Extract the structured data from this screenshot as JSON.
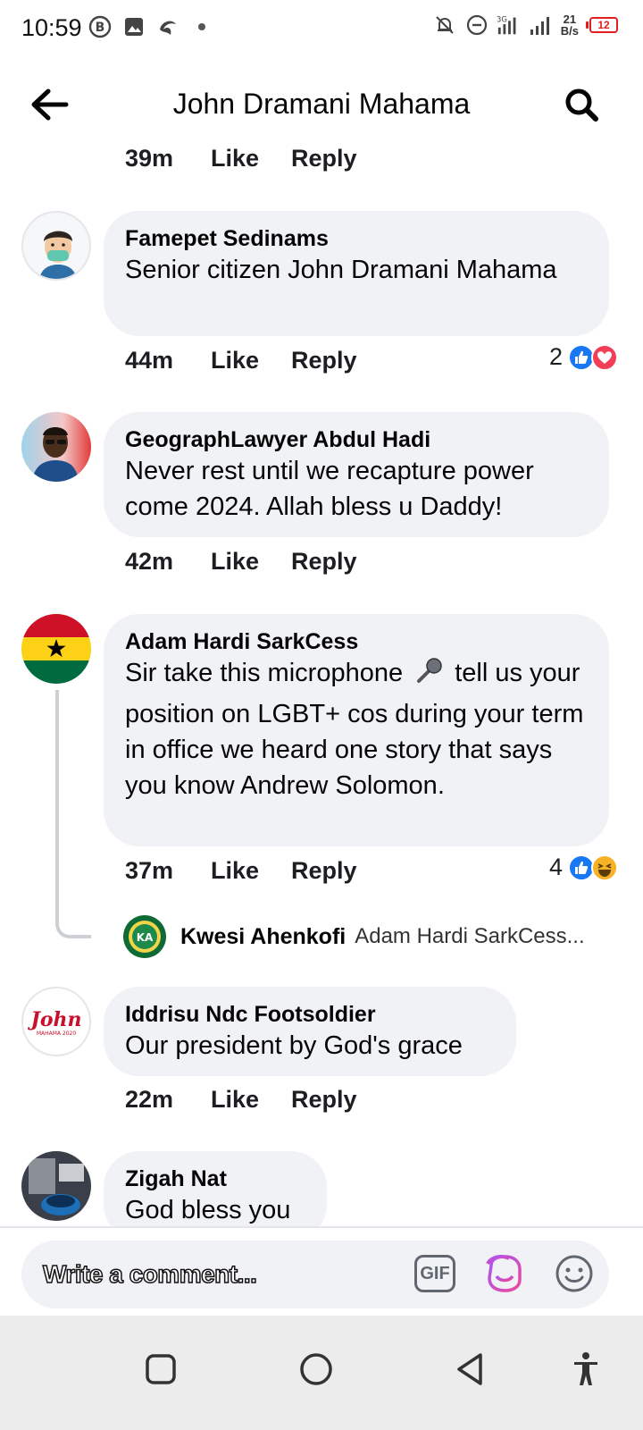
{
  "status_bar": {
    "time": "10:59",
    "network_speed_value": "21",
    "network_speed_unit": "B/s",
    "battery": "12"
  },
  "header": {
    "title": "John Dramani Mahama"
  },
  "prev_comment": {
    "time": "39m",
    "like": "Like",
    "reply": "Reply"
  },
  "comments": [
    {
      "author": "Famepet Sedinams",
      "text": "Senior citizen John Dramani Mahama",
      "time": "44m",
      "like": "Like",
      "reply": "Reply",
      "reaction_count": "2",
      "reactions": [
        "like-icon",
        "love-icon"
      ]
    },
    {
      "author": "GeographLawyer Abdul Hadi",
      "text": "Never rest until we recapture power come 2024. Allah bless u Daddy!",
      "time": "42m",
      "like": "Like",
      "reply": "Reply"
    },
    {
      "author": "Adam Hardi SarkCess",
      "text_before": "Sir take this microphone",
      "text_after": "tell us your position on LGBT+ cos during your term in office we heard one story that says you know Andrew Solomon.",
      "time": "37m",
      "like": "Like",
      "reply": "Reply",
      "reaction_count": "4",
      "reactions": [
        "like-icon",
        "haha-icon"
      ],
      "reply_preview": {
        "author": "Kwesi Ahenkofi",
        "snippet": "Adam Hardi SarkCess..."
      }
    },
    {
      "author": "Iddrisu Ndc Footsoldier",
      "text": "Our president by God's grace",
      "time": "22m",
      "like": "Like",
      "reply": "Reply",
      "avatar_logo_text": "John",
      "avatar_logo_subtext": "MAHAMA 2020"
    },
    {
      "author": "Zigah Nat",
      "text": "God bless you"
    }
  ],
  "composer": {
    "placeholder": "Write a comment...",
    "gif_label": "GIF"
  },
  "colors": {
    "bubble": "#f0f2f5",
    "facebook_blue": "#1877f2",
    "love_red": "#f33e58",
    "haha_yellow": "#f7b125"
  }
}
